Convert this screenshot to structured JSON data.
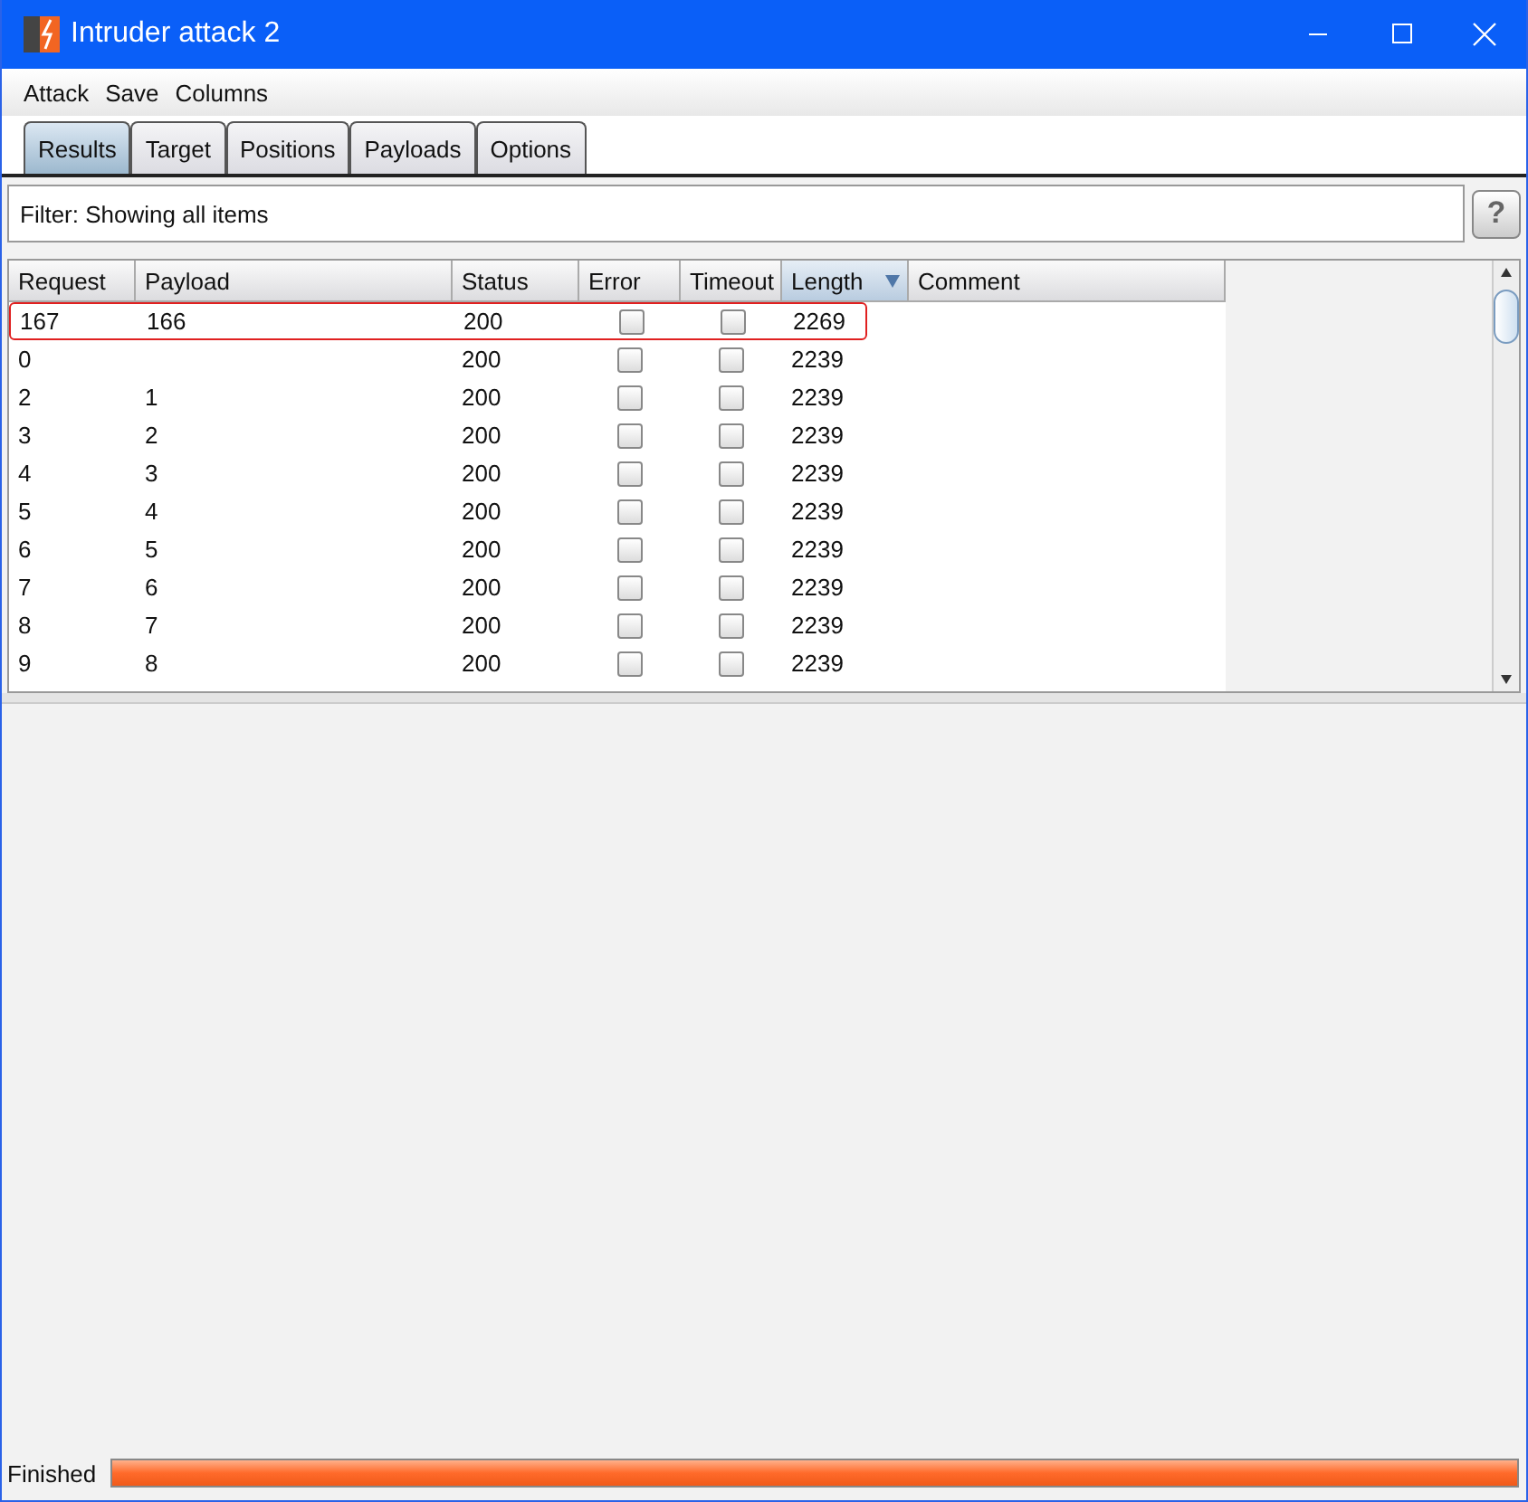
{
  "window": {
    "title": "Intruder attack 2"
  },
  "menu": [
    "Attack",
    "Save",
    "Columns"
  ],
  "tabs": [
    {
      "label": "Results",
      "selected": true
    },
    {
      "label": "Target",
      "selected": false
    },
    {
      "label": "Positions",
      "selected": false
    },
    {
      "label": "Payloads",
      "selected": false
    },
    {
      "label": "Options",
      "selected": false
    }
  ],
  "filter": {
    "text": "Filter: Showing all items",
    "help": "?"
  },
  "table": {
    "columns": [
      {
        "label": "Request",
        "sorted": false
      },
      {
        "label": "Payload",
        "sorted": false
      },
      {
        "label": "Status",
        "sorted": false
      },
      {
        "label": "Error",
        "sorted": false
      },
      {
        "label": "Timeout",
        "sorted": false
      },
      {
        "label": "Length",
        "sorted": true
      },
      {
        "label": "Comment",
        "sorted": false
      }
    ],
    "rows": [
      {
        "request": "167",
        "payload": "166",
        "status": "200",
        "error": false,
        "timeout": false,
        "length": "2269",
        "highlighted": true
      },
      {
        "request": "0",
        "payload": "",
        "status": "200",
        "error": false,
        "timeout": false,
        "length": "2239",
        "highlighted": false
      },
      {
        "request": "2",
        "payload": "1",
        "status": "200",
        "error": false,
        "timeout": false,
        "length": "2239",
        "highlighted": false
      },
      {
        "request": "3",
        "payload": "2",
        "status": "200",
        "error": false,
        "timeout": false,
        "length": "2239",
        "highlighted": false
      },
      {
        "request": "4",
        "payload": "3",
        "status": "200",
        "error": false,
        "timeout": false,
        "length": "2239",
        "highlighted": false
      },
      {
        "request": "5",
        "payload": "4",
        "status": "200",
        "error": false,
        "timeout": false,
        "length": "2239",
        "highlighted": false
      },
      {
        "request": "6",
        "payload": "5",
        "status": "200",
        "error": false,
        "timeout": false,
        "length": "2239",
        "highlighted": false
      },
      {
        "request": "7",
        "payload": "6",
        "status": "200",
        "error": false,
        "timeout": false,
        "length": "2239",
        "highlighted": false
      },
      {
        "request": "8",
        "payload": "7",
        "status": "200",
        "error": false,
        "timeout": false,
        "length": "2239",
        "highlighted": false
      },
      {
        "request": "9",
        "payload": "8",
        "status": "200",
        "error": false,
        "timeout": false,
        "length": "2239",
        "highlighted": false
      }
    ]
  },
  "status_bar": {
    "text": "Finished",
    "level": 1
  }
}
